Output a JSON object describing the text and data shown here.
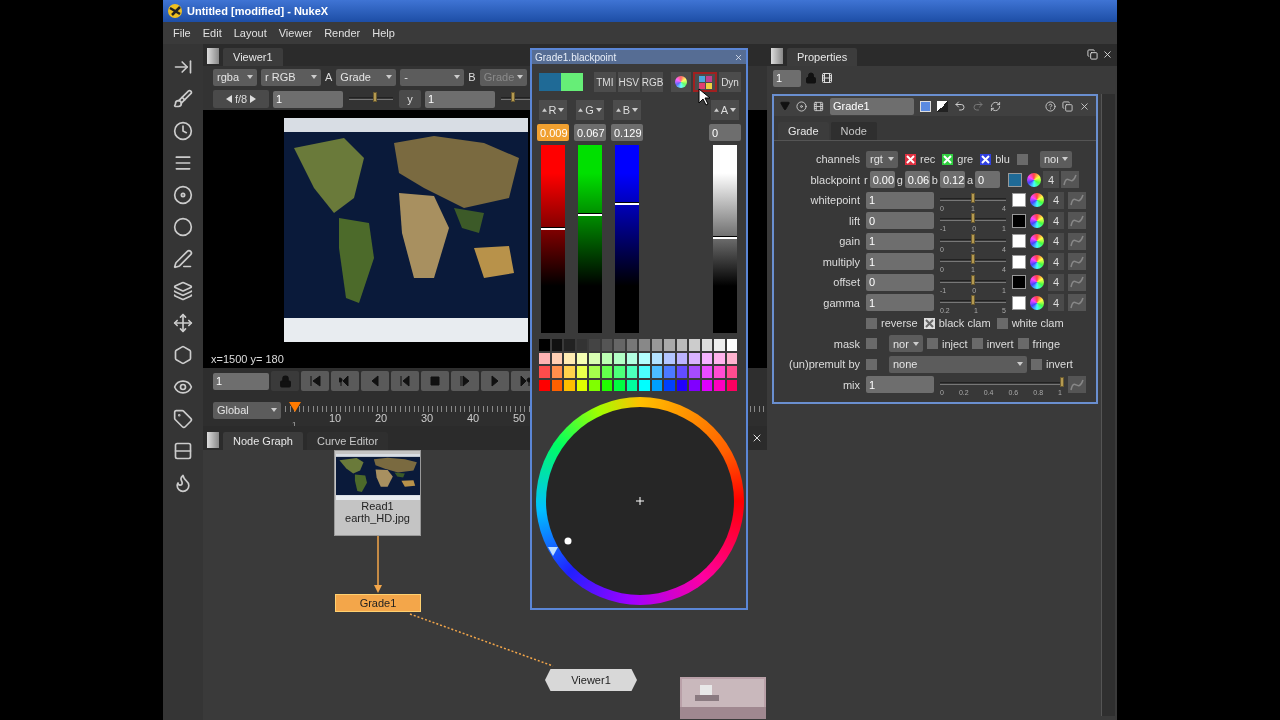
{
  "window": {
    "title": "Untitled [modified] - NukeX"
  },
  "menu": [
    "File",
    "Edit",
    "Layout",
    "Viewer",
    "Render",
    "Help"
  ],
  "viewer": {
    "tab": "Viewer1",
    "row1": [
      {
        "kind": "dropdown",
        "value": "rgba",
        "disabled": false
      },
      {
        "kind": "dropdown",
        "value": "r RGB",
        "disabled": false
      },
      {
        "kind": "label",
        "value": "A",
        "disabled": false
      },
      {
        "kind": "dropdown",
        "value": "Grade",
        "disabled": false
      },
      {
        "kind": "dropdown",
        "value": "-",
        "disabled": false
      },
      {
        "kind": "label",
        "value": "B",
        "disabled": false
      },
      {
        "kind": "dropdown",
        "value": "Grade",
        "disabled": true
      }
    ],
    "fstop": "f/8",
    "gain": "1",
    "gamma_label": "y",
    "gamma": "1",
    "coords": "x=1500 y= 180",
    "frame": "1",
    "range": "Global",
    "timeline": {
      "start_label": "1",
      "labels": [
        "10",
        "20",
        "30",
        "40",
        "50"
      ]
    }
  },
  "node_graph": {
    "tabs": [
      {
        "label": "Node Graph",
        "selected": true
      },
      {
        "label": "Curve Editor",
        "selected": false
      }
    ],
    "nodes": [
      {
        "kind": "read",
        "name": "Read1",
        "file": "earth_HD.jpg",
        "selected": false
      },
      {
        "kind": "grade",
        "name": "Grade1",
        "selected": true
      },
      {
        "kind": "viewer",
        "name": "Viewer1",
        "selected": false
      }
    ]
  },
  "picker": {
    "title": "Grade1.blackpoint",
    "swatches": [
      {
        "color": "#1f6a96"
      },
      {
        "color": "#66ee77"
      }
    ],
    "modes": [
      {
        "label": "TMI"
      },
      {
        "label": "HSV"
      },
      {
        "label": "RGB"
      }
    ],
    "dyn": "Dyn",
    "channels": [
      {
        "label": "R",
        "value": "0.009",
        "selected": true,
        "level": 0.55,
        "color": "#ff0000"
      },
      {
        "label": "G",
        "value": "0.067",
        "selected": false,
        "level": 0.62,
        "color": "#00e000"
      },
      {
        "label": "B",
        "value": "0.129",
        "selected": false,
        "level": 0.68,
        "color": "#0000ff"
      },
      {
        "label": "A",
        "value": "0",
        "selected": false,
        "level": 0.5,
        "color": "#ffffff"
      }
    ]
  },
  "properties": {
    "title": "Properties",
    "count": "1",
    "node_name": "Grade1",
    "tabs": [
      {
        "label": "Grade",
        "selected": true
      },
      {
        "label": "Node",
        "selected": false
      }
    ],
    "channels": {
      "label": "channels",
      "dropdown": "rgt",
      "checks": [
        {
          "label": "rec",
          "checked": true,
          "color": "#e03040"
        },
        {
          "label": "gre",
          "checked": true,
          "color": "#30d040"
        },
        {
          "label": "blu",
          "checked": true,
          "color": "#3040e0"
        },
        {
          "checked": false
        }
      ],
      "extra": "noı"
    },
    "blackpoint": {
      "label": "blackpoint",
      "components": [
        {
          "name": "r",
          "value": "0.00"
        },
        {
          "name": "g",
          "value": "0.06"
        },
        {
          "name": "b",
          "value": "0.12"
        },
        {
          "name": "a",
          "value": "0"
        }
      ],
      "color": "#1f6a96",
      "count": "4"
    },
    "knobs": [
      {
        "label": "whitepoint",
        "value": "1",
        "level": 0.5,
        "ticks": [
          "0",
          "1",
          "4"
        ],
        "color": "#ffffff",
        "count": "4"
      },
      {
        "label": "lift",
        "value": "0",
        "level": 0.5,
        "ticks": [
          "-1",
          "0",
          "1"
        ],
        "color": "#000000",
        "count": "4"
      },
      {
        "label": "gain",
        "value": "1",
        "level": 0.5,
        "ticks": [
          "0",
          "1",
          "4"
        ],
        "color": "#ffffff",
        "count": "4"
      },
      {
        "label": "multiply",
        "value": "1",
        "level": 0.5,
        "ticks": [
          "0",
          "1",
          "4"
        ],
        "color": "#ffffff",
        "count": "4"
      },
      {
        "label": "offset",
        "value": "0",
        "level": 0.5,
        "ticks": [
          "-1",
          "0",
          "1"
        ],
        "color": "#000000",
        "count": "4"
      },
      {
        "label": "gamma",
        "value": "1",
        "level": 0.5,
        "ticks": [
          "0.2",
          "1",
          "5"
        ],
        "color": "#ffffff",
        "count": "4"
      }
    ],
    "options": [
      {
        "label": "reverse",
        "checked": false
      },
      {
        "label": "black clam",
        "checked": true
      },
      {
        "label": "white clam",
        "checked": false
      }
    ],
    "mask": {
      "label": "mask",
      "checked": false,
      "dropdown": "nor",
      "options": [
        {
          "label": "inject",
          "checked": false
        },
        {
          "label": "invert",
          "checked": false
        },
        {
          "label": "fringe",
          "checked": false
        }
      ]
    },
    "premult": {
      "label": "(un)premult by",
      "checked": false,
      "dropdown": "none",
      "invert": {
        "label": "invert",
        "checked": false
      }
    },
    "mix": {
      "label": "mix",
      "value": "1",
      "level": 1,
      "ticks": [
        "0",
        "0.2",
        "0.4",
        "0.6",
        "0.8",
        "1"
      ]
    }
  }
}
